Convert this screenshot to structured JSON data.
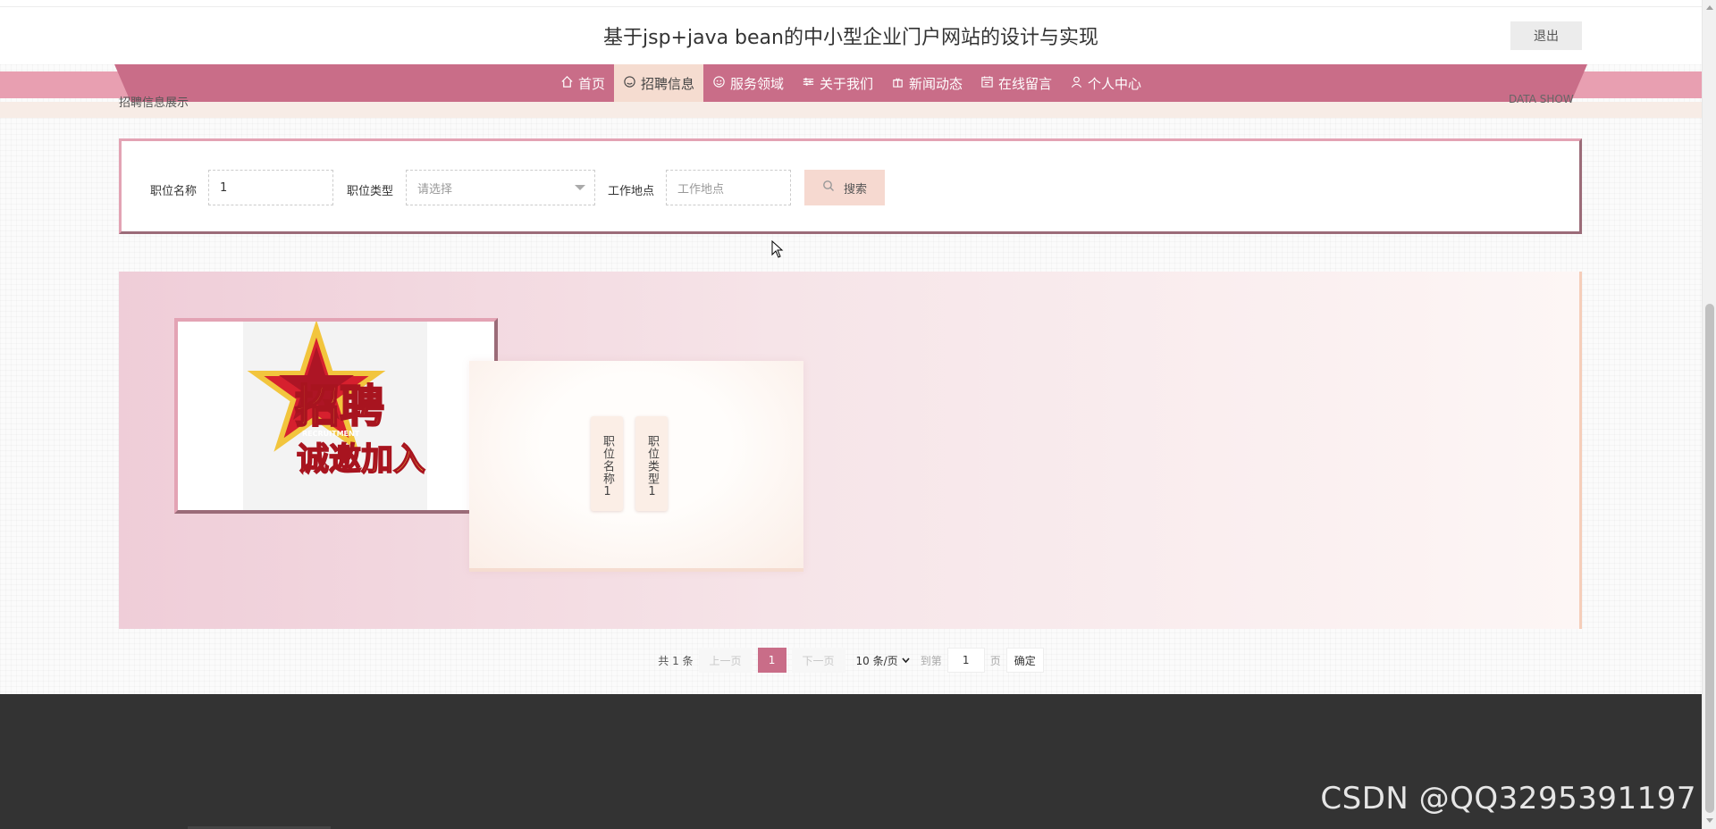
{
  "header": {
    "title": "基于jsp+java bean的中小型企业门户网站的设计与实现",
    "logout_label": "退出"
  },
  "nav": {
    "items": [
      {
        "label": "首页",
        "icon": "home-icon"
      },
      {
        "label": "招聘信息",
        "icon": "smile-icon",
        "active": true
      },
      {
        "label": "服务领域",
        "icon": "face-icon"
      },
      {
        "label": "关于我们",
        "icon": "sliders-icon"
      },
      {
        "label": "新闻动态",
        "icon": "gift-icon"
      },
      {
        "label": "在线留言",
        "icon": "calendar-icon"
      },
      {
        "label": "个人中心",
        "icon": "user-icon"
      }
    ],
    "accent": "#c96d88",
    "active_bg": "#f5dcd0"
  },
  "subbar": {
    "left_text": "招聘信息展示",
    "right_text": "DATA SHOW"
  },
  "search": {
    "position_label": "职位名称",
    "position_value": "1",
    "type_label": "职位类型",
    "type_placeholder": "请选择",
    "location_label": "工作地点",
    "location_placeholder": "工作地点",
    "search_label": "搜索"
  },
  "results": {
    "items": [
      {
        "image_alt": "招聘 诚邀加入 RECRUITMENT",
        "tag1": "职位名称1",
        "tag2": "职位类型1"
      }
    ]
  },
  "pager": {
    "total": "共 1 条",
    "prev": "上一页",
    "current": "1",
    "next": "下一页",
    "page_size": "10 条/页",
    "goto_label": "到第",
    "goto_value": "1",
    "page_unit": "页",
    "confirm": "确定"
  },
  "watermark": "CSDN @QQ3295391197"
}
